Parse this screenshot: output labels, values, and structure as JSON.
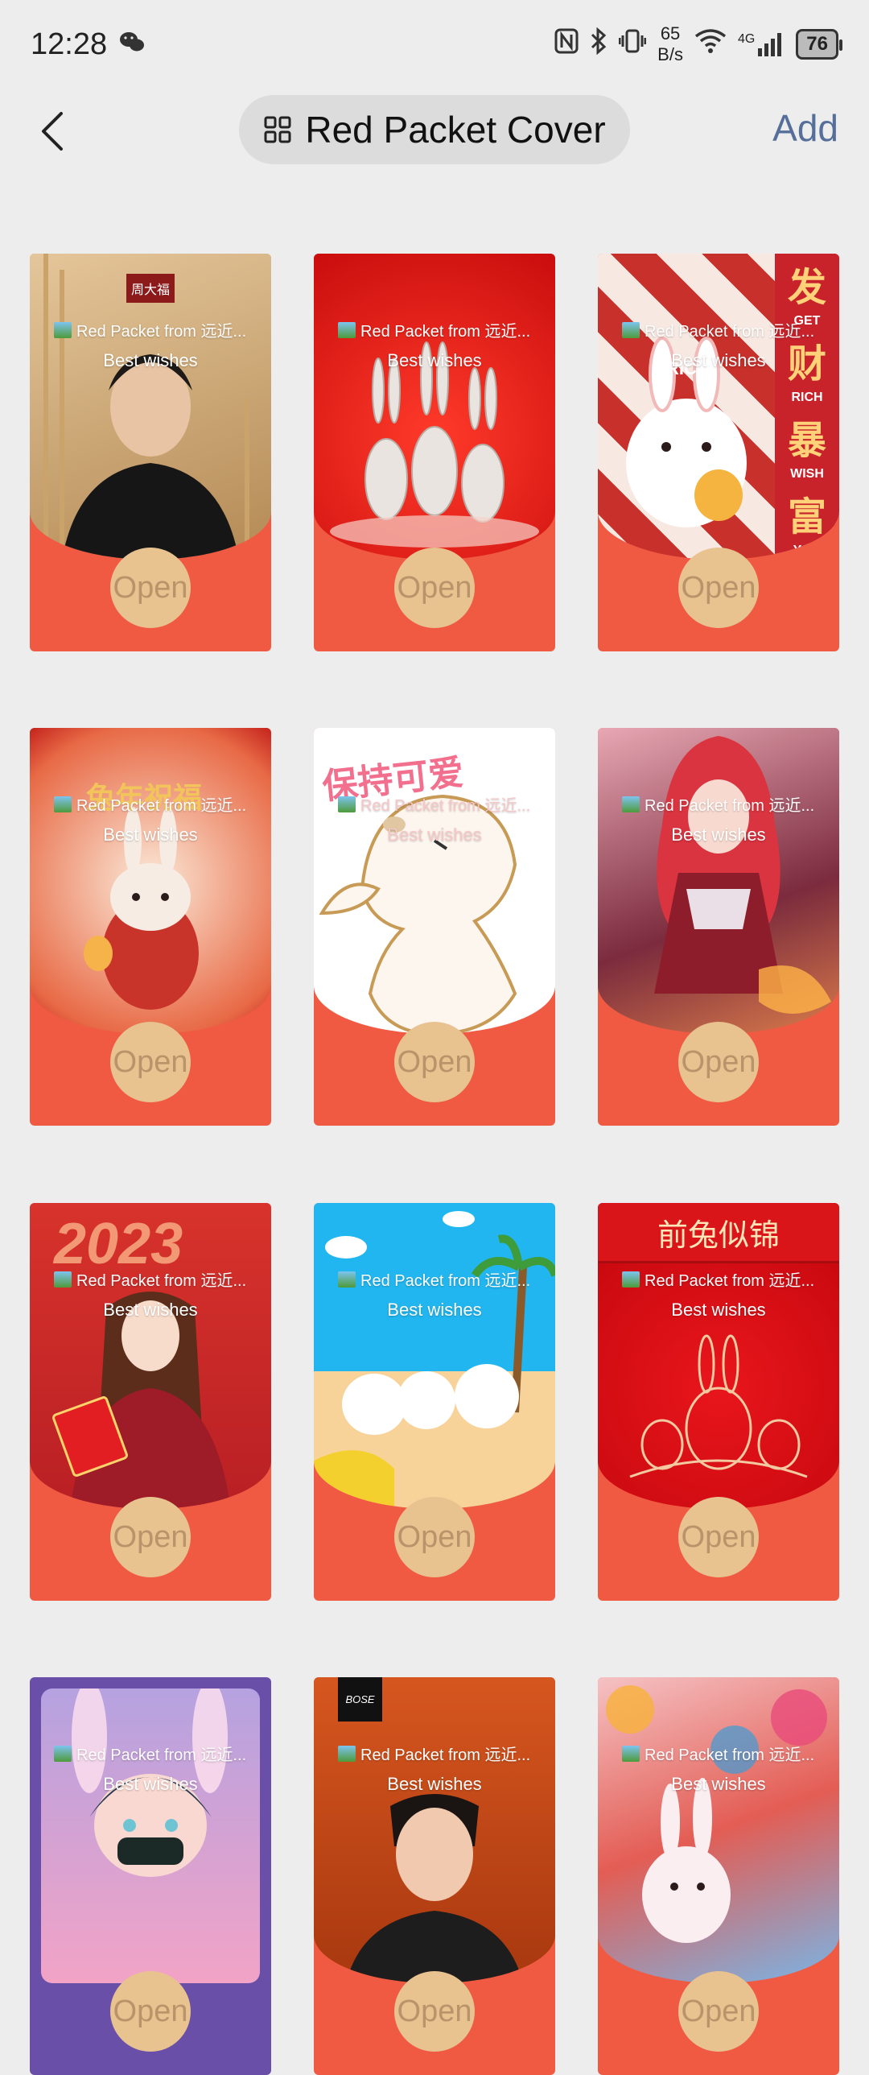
{
  "status": {
    "time": "12:28",
    "speed_value": "65",
    "speed_unit": "B/s",
    "battery": "76",
    "network": "4G"
  },
  "header": {
    "title": "Red Packet Cover",
    "add_label": "Add"
  },
  "cards": [
    {
      "sender": "Red Packet from 远近...",
      "wish": "Best wishes",
      "open": "Open",
      "brand": "周大福"
    },
    {
      "sender": "Red Packet from 远近...",
      "wish": "Best wishes",
      "open": "Open"
    },
    {
      "sender": "Red Packet from 远近...",
      "wish": "Best wishes",
      "open": "Open",
      "side_text": [
        "发",
        "GET",
        "财",
        "RICH",
        "暴",
        "WISH",
        "富",
        "YOU"
      ],
      "tag": "RICH"
    },
    {
      "sender": "Red Packet from 远近...",
      "wish": "Best wishes",
      "open": "Open",
      "banner": "兔年祝福"
    },
    {
      "sender": "Red Packet from 远近...",
      "wish": "Best wishes",
      "open": "Open",
      "banner": "保持可爱"
    },
    {
      "sender": "Red Packet from 远近...",
      "wish": "Best wishes",
      "open": "Open"
    },
    {
      "sender": "Red Packet from 远近...",
      "wish": "Best wishes",
      "open": "Open",
      "banner": "2023"
    },
    {
      "sender": "Red Packet from 远近...",
      "wish": "Best wishes",
      "open": "Open"
    },
    {
      "sender": "Red Packet from 远近...",
      "wish": "Best wishes",
      "open": "Open",
      "banner": "前兔似锦"
    },
    {
      "sender": "Red Packet from 远近...",
      "wish": "Best wishes",
      "open": "Open"
    },
    {
      "sender": "Red Packet from 远近...",
      "wish": "Best wishes",
      "open": "Open",
      "brand": "BOSE"
    },
    {
      "sender": "Red Packet from 远近...",
      "wish": "Best wishes",
      "open": "Open"
    }
  ]
}
